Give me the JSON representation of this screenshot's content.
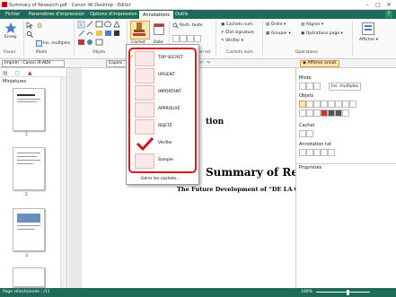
{
  "window": {
    "title": "Summary of Research.pdf - Canon iW Desktop - Editor",
    "minimize": "–",
    "maximize": "□",
    "close": "✕"
  },
  "tabs": [
    "Fichier",
    "Paramètres d'impression",
    "Options d'impression",
    "Annotations",
    "Outils"
  ],
  "help": "?",
  "ribbon": {
    "favori": {
      "label": "Favori",
      "button": "Enreg."
    },
    "mode": {
      "label": "Mode",
      "button": "Ins. multiples"
    },
    "objets": {
      "label": "Objets"
    },
    "cachet": {
      "label": "Cachet",
      "date": "Date"
    },
    "annotation": {
      "label": "Annotation txt",
      "rech": "Rech. texte"
    },
    "cachets_num": {
      "label": "Cachets num.",
      "item1": "Cachets num.",
      "item2": "État signature",
      "item3": "Vérifier"
    },
    "operations": {
      "label": "Opérations",
      "ordre": "Ordre",
      "grouper": "Grouper",
      "aligner": "Aligner",
      "ops_page": "Opérations page"
    },
    "afficher": {
      "label": "Afficher"
    }
  },
  "quickbar": {
    "printer": "Imprim : Canon iR-ADV",
    "copies": "Copies :",
    "afficher_annot": "Afficher annot."
  },
  "left_panel": {
    "title": "Miniatures",
    "pages": [
      "1",
      "2",
      "3"
    ]
  },
  "document": {
    "heading_partial": "tion",
    "title_partial": "Summary of Resea",
    "subtitle_partial": "The Future Development of “DE LA C"
  },
  "dropdown": {
    "items": [
      "TOP SECRET",
      "URGENT",
      "IMPORTANT",
      "APPROUVÉ",
      "REJETÉ",
      "Vérifier",
      "Sample"
    ],
    "manage": "Gérer les cachets..."
  },
  "right_panel": {
    "mode": "Mode",
    "multi": "Ins. multiples",
    "objets": "Objets",
    "cachet": "Cachet",
    "annotation": "Annotation txt",
    "proprietes": "Propriétés"
  },
  "status": {
    "page": "Page sélectionnée : /11",
    "zoom": "100%"
  },
  "colors": {
    "accent": "#1f6b5a",
    "stamp_red": "#e0141b"
  }
}
